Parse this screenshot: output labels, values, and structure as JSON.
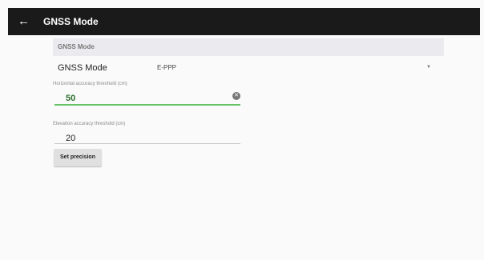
{
  "toolbar": {
    "back_icon": "arrow-back-icon",
    "title": "GNSS Mode"
  },
  "section": {
    "header": "GNSS Mode"
  },
  "gnss_mode": {
    "label": "GNSS Mode",
    "value": "E-PPP",
    "dropdown_icon": "caret-down-icon"
  },
  "horizontal": {
    "label": "Horizontal accuracy threshold (cm)",
    "value": "50",
    "clear_icon": "clear-icon"
  },
  "elevation": {
    "label": "Elevation accuracy threshold (cm)",
    "value": "20"
  },
  "actions": {
    "set_precision": "Set precision"
  },
  "colors": {
    "toolbar_bg": "#1a1a1a",
    "focus_accent": "#67c267",
    "section_bg": "#ebebef"
  }
}
